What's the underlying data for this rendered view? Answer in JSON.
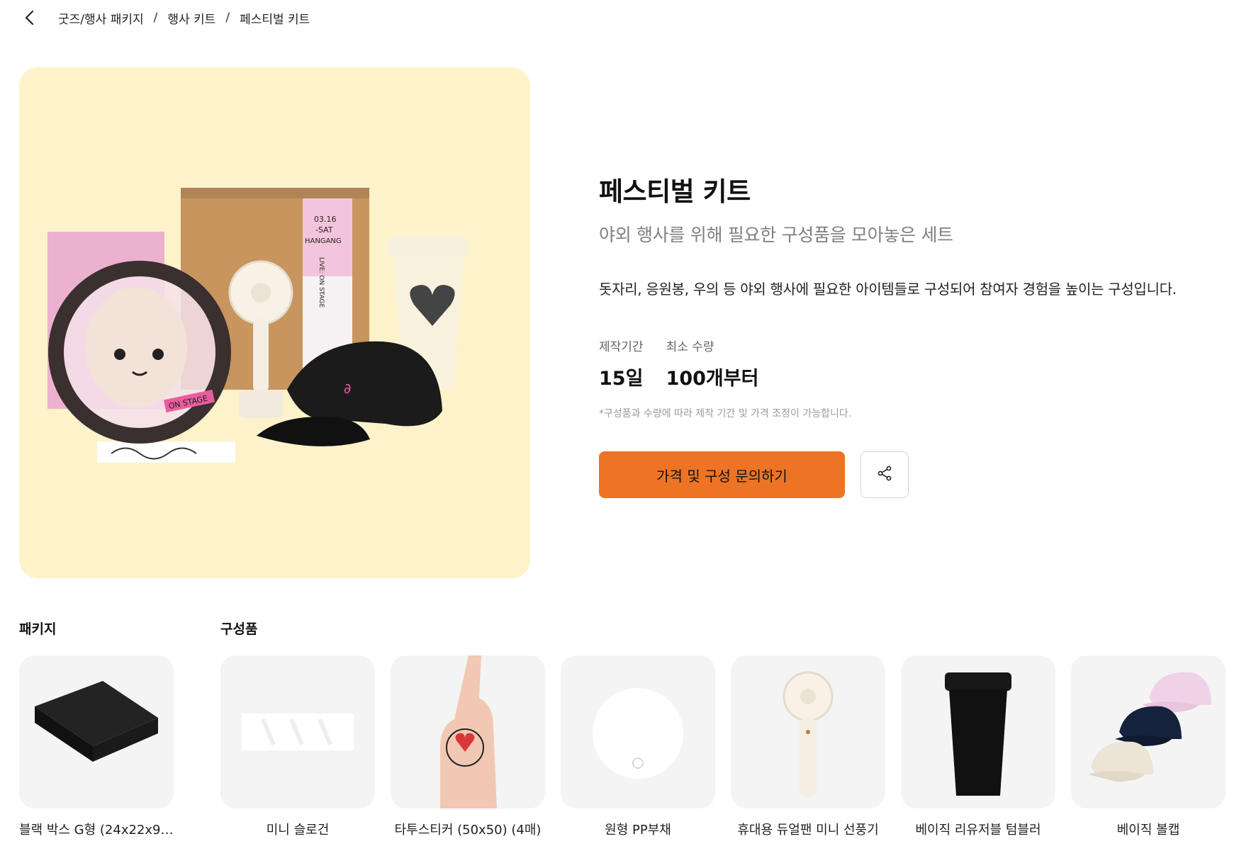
{
  "breadcrumb": {
    "items": [
      "굿즈/행사 패키지",
      "행사 키트",
      "페스티벌 키트"
    ],
    "separator": "/"
  },
  "product": {
    "title": "페스티벌 키트",
    "subtitle": "야외 행사를 위해 필요한 구성품을 모아놓은 세트",
    "description": "돗자리, 응원봉, 우의 등 야외 행사에 필요한 아이템들로 구성되어 참여자 경험을 높이는 구성입니다.",
    "meta": [
      {
        "label": "제작기간",
        "value": "15일"
      },
      {
        "label": "최소 수량",
        "value": "100개부터"
      }
    ],
    "note": "*구성품과 수량에 따라 제작 기간 및 가격 조정이 가능합니다.",
    "cta_label": "가격 및 구성 문의하기",
    "image_texts": {
      "date": "03.16",
      "day": "-SAT",
      "venue": "HANGANG",
      "live": "LIVE: ON STAGE",
      "fan_sticker": "ON STAGE"
    }
  },
  "sections": {
    "package_label": "패키지",
    "components_label": "구성품"
  },
  "items": [
    {
      "caption": "블랙 박스 G형 (24x22x9...."
    },
    {
      "caption": "미니 슬로건"
    },
    {
      "caption": "타투스티커 (50x50) (4매)"
    },
    {
      "caption": "원형 PP부채"
    },
    {
      "caption": "휴대용 듀얼팬 미니 선풍기"
    },
    {
      "caption": "베이직 리유저블 텀블러"
    },
    {
      "caption": "베이직 볼캡"
    }
  ],
  "colors": {
    "accent": "#ed7424",
    "hero_bg": "#fdf2c9",
    "card_bg": "#f4f4f4"
  },
  "icons": [
    "chevron-left-icon",
    "share-icon"
  ]
}
